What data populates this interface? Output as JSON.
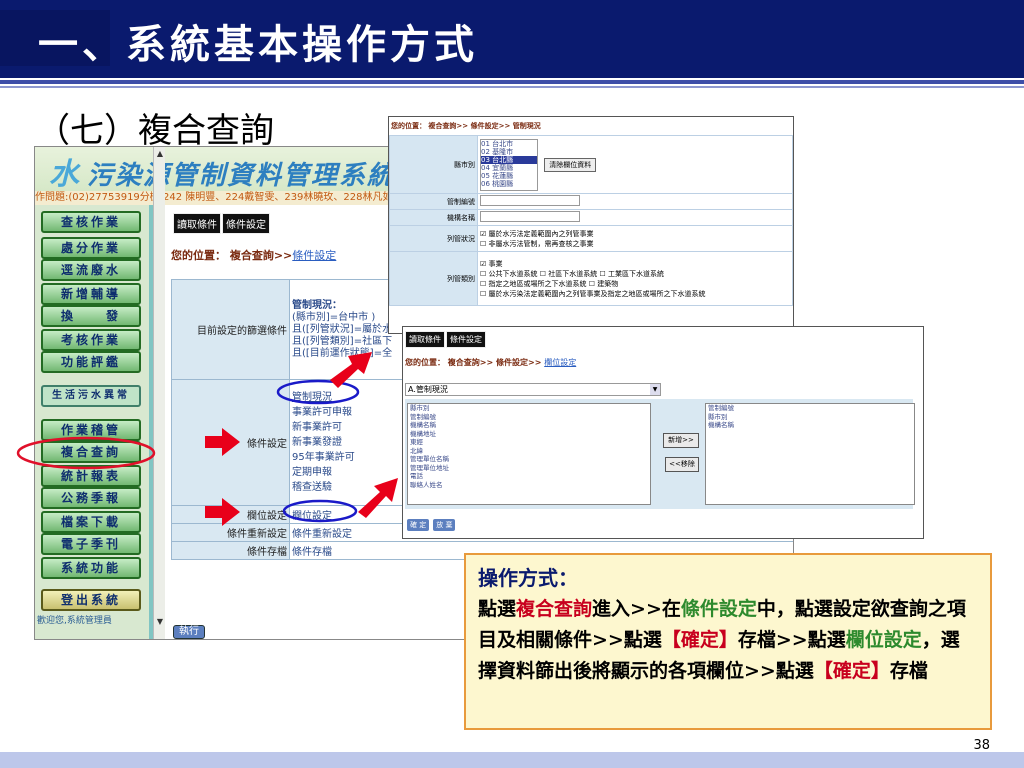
{
  "slide": {
    "title": "一、系統基本操作方式",
    "subtitle": "（七）複合查詢",
    "page": "38"
  },
  "app": {
    "logo_water": "水",
    "logo_text": "污染源管制資料管理系統",
    "ticker": "作問題:(02)27753919分機 242 陳明豐、224戴智雯、239林曉玫、228林凡如；",
    "sidebar": [
      "查核作業",
      "處分作業",
      "逕流廢水",
      "新增輔導",
      "換　　發",
      "考核作業",
      "功能評鑑"
    ],
    "sidebar2": "生活污水異常",
    "sidebar3": [
      "作業稽管",
      "複合查詢",
      "統計報表",
      "公務季報",
      "檔案下載",
      "電子季刊",
      "系統功能"
    ],
    "logout": "登出系統",
    "welcome": "歡迎您,系統管理員",
    "tabs": [
      "讀取條件",
      "條件設定"
    ],
    "location": {
      "prefix": "您的位置：",
      "path": "複合查詢>>",
      "link": "條件設定"
    },
    "grid": {
      "row1_label": "目前設定的篩選條件",
      "row1_lines": [
        "管制現況：",
        "(縣市別]=台中市 )",
        "且([列管狀況]=屬於水",
        "且([列管類別]=社區下",
        "且([目前運作狀態]=全"
      ],
      "row2_label": "條件設定",
      "row2_items": [
        "管制現況",
        "事業許可申報",
        "新事業許可",
        "新事業發證",
        "95年事業許可",
        "定期申報",
        "稽查送驗"
      ],
      "row3_label": "欄位設定",
      "row3_value": "欄位設定",
      "row4_label": "條件重新設定",
      "row4_value": "條件重新設定",
      "row5_label": "條件存檔",
      "row5_value": "條件存檔"
    },
    "exec": "執行"
  },
  "win1": {
    "breadcrumb": "您的位置： 複合查詢>> 條件設定>> 管制現況",
    "county_label": "縣市別",
    "counties": [
      "01 台北市",
      "02 基隆市",
      "03 台北縣",
      "04 宜蘭縣",
      "05 花蓮縣",
      "06 桃園縣"
    ],
    "clear_btn": "清除欄位資料",
    "ctrl_no": "管制編號",
    "org_name": "機構名稱",
    "status_label": "列管狀況",
    "status_opts": [
      "屬於水污法定義範圍內之列管事業",
      "非屬水污法管制，需再查核之事業"
    ],
    "type_label": "列管類別",
    "type_opts": [
      "事業",
      "公共下水道系統",
      "社區下水道系統",
      "工業區下水道系統",
      "指定之地區或場所之下水道系統",
      "建築物",
      "屬於水污染法定義範圍內之列管事業及指定之地區或場所之下水道系統"
    ]
  },
  "win2": {
    "tabs": [
      "讀取條件",
      "條件設定"
    ],
    "breadcrumb_prefix": "您的位置：",
    "breadcrumb": "複合查詢>> 條件設定>>",
    "breadcrumb_link": "欄位設定",
    "select": "A.管制現況",
    "left_list": [
      "縣市別",
      "管制編號",
      "機構名稱",
      "機構地址",
      "東經",
      "北緯",
      "管理單位名稱",
      "管理單位地址",
      "電話",
      "聯絡人姓名"
    ],
    "add_btn": "新增>>",
    "remove_btn": "<<移除",
    "right_list": [
      "管制編號",
      "縣市別",
      "機構名稱"
    ],
    "ok_btns": [
      "確 定",
      "放 棄"
    ]
  },
  "note": {
    "heading": "操作方式：",
    "p1a": "點選",
    "p1b": "複合查詢",
    "p1c": "進入>>在",
    "p1d": "條件設定",
    "p1e": "中，點選設定欲查詢之項目及相關條件>>點選",
    "p1f": "【確定】",
    "p1g": "存檔>>點選",
    "p1h": "欄位設定",
    "p1i": "，選擇資料篩出後將顯示的各項欄位>>點選",
    "p1j": "【確定】",
    "p1k": "存檔"
  },
  "colors": {
    "title_bg": "#0a1a6e",
    "note_border": "#e89a3c",
    "highlight_red": "#c8001e",
    "highlight_green": "#2d8a2d",
    "arrow_red": "#e8001a",
    "oval_blue": "#1a1ac8",
    "oval_red": "#e0102a"
  }
}
